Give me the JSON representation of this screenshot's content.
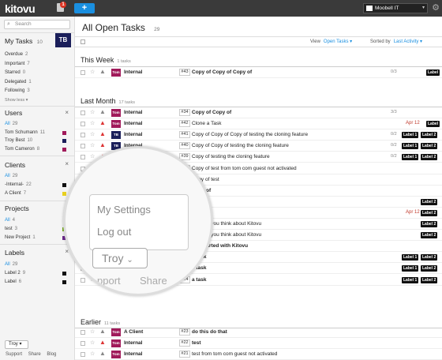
{
  "topbar": {
    "logo": "kitovu",
    "notif_count": "1",
    "add_label": "+",
    "org": "Moobell IT",
    "org_caret": "▾",
    "gear": "⚙"
  },
  "sidebar": {
    "search_placeholder": "Search",
    "mytasks": {
      "title": "My Tasks",
      "count": "10",
      "badge": "TB",
      "items": [
        {
          "label": "Overdue",
          "count": "2"
        },
        {
          "label": "Important",
          "count": "7"
        },
        {
          "label": "Starred",
          "count": "0"
        },
        {
          "label": "Delegated",
          "count": "1"
        },
        {
          "label": "Following",
          "count": "3"
        }
      ],
      "show_less": "Show less ▾"
    },
    "users": {
      "title": "Users",
      "close": "×",
      "items": [
        {
          "label": "All",
          "count": "29"
        },
        {
          "label": "Tom Schumann",
          "count": "11"
        },
        {
          "label": "Troy Best",
          "count": "10"
        },
        {
          "label": "Tom Cameron",
          "count": "8"
        }
      ]
    },
    "clients": {
      "title": "Clients",
      "close": "×",
      "items": [
        {
          "label": "All",
          "count": "29"
        },
        {
          "label": "-Internal-",
          "count": "22"
        },
        {
          "label": "A Client",
          "count": "7"
        }
      ]
    },
    "projects": {
      "title": "Projects",
      "close": "×",
      "items": [
        {
          "label": "All",
          "count": "4"
        },
        {
          "label": "test",
          "count": "3"
        },
        {
          "label": "New Project",
          "count": "1"
        }
      ]
    },
    "labels": {
      "title": "Labels",
      "close": "×",
      "items": [
        {
          "label": "All",
          "count": "29"
        },
        {
          "label": "Label 2",
          "count": "9"
        },
        {
          "label": "Label",
          "count": "6"
        }
      ]
    },
    "footer": {
      "user_button": "Troy ▾",
      "support": "Support",
      "share": "Share",
      "blog": "Blog"
    }
  },
  "main": {
    "title": "All Open Tasks",
    "count": "29",
    "view_label": "View",
    "view_value": "Open Tasks ▾",
    "sort_label": "Sorted by",
    "sort_value": "Last Activity ▾",
    "sections": [
      {
        "title": "This Week",
        "count": "1 tasks"
      },
      {
        "title": "Last Month",
        "count": "17 tasks"
      },
      {
        "title": "Earlier",
        "count": "11 tasks"
      }
    ],
    "rows_this_week": [
      {
        "av": "Tom",
        "project": "Internal",
        "num": "#43",
        "title": "Copy of Copy of Copy of",
        "bold": true,
        "sub": "0/3",
        "labels": [
          "Label"
        ]
      }
    ],
    "rows_last_month": [
      {
        "av": "Tom",
        "project": "Internal",
        "num": "#34",
        "title": "Copy of Copy of",
        "bold": true,
        "sub": "3/3",
        "labels": []
      },
      {
        "av": "Tom",
        "project": "Internal",
        "num": "#42",
        "title": "Clone a Task",
        "bold": false,
        "date": "Apr 12",
        "labels": [
          "Label"
        ]
      },
      {
        "av": "TB",
        "project": "Internal",
        "num": "#41",
        "title": "Copy of Copy of Copy of testing the cloning feature",
        "bold": false,
        "sub": "0/2",
        "labels": [
          "Label 1",
          "Label 2"
        ]
      },
      {
        "av": "TB",
        "project": "Internal",
        "num": "#40",
        "title": "Copy of Copy of testing the cloning feature",
        "bold": false,
        "sub": "0/2",
        "labels": [
          "Label 1",
          "Label 2"
        ]
      },
      {
        "av": "TB",
        "project": "Internal",
        "num": "#39",
        "title": "Copy of testing the cloning feature",
        "bold": false,
        "sub": "0/2",
        "labels": [
          "Label 1",
          "Label 2"
        ]
      },
      {
        "av": "",
        "project": "",
        "num": "#36",
        "title": "Copy of test from tom com guest not activated",
        "bold": false,
        "labels": []
      },
      {
        "av": "",
        "project": "",
        "num": "#35",
        "title": "Copy of test",
        "bold": false,
        "labels": []
      },
      {
        "av": "",
        "project": "",
        "num": "",
        "title": "Copy of",
        "bold": true,
        "labels": []
      },
      {
        "av": "",
        "project": "",
        "num": "",
        "title": "",
        "bold": false,
        "labels": [
          "Label 2"
        ]
      },
      {
        "av": "",
        "project": "",
        "num": "",
        "title": "",
        "bold": false,
        "date": "Apr 12",
        "labels": [
          "Label 2"
        ]
      },
      {
        "av": "",
        "project": "",
        "num": "",
        "title": "us what you think about Kitovu",
        "bold": false,
        "labels": [
          "Label 2"
        ]
      },
      {
        "av": "",
        "project": "",
        "num": "",
        "title": "us what you think about Kitovu",
        "bold": false,
        "labels": [
          "Label 2"
        ]
      },
      {
        "av": "",
        "project": "",
        "num": "",
        "title": "Get started with Kitovu",
        "bold": true,
        "labels": []
      },
      {
        "av": "",
        "project": "",
        "num": "#26",
        "title": "a task",
        "bold": true,
        "labels": [
          "Label 1",
          "Label 2"
        ]
      },
      {
        "av": "Tom",
        "project": "",
        "num": "#25",
        "title": "a task",
        "bold": true,
        "labels": [
          "Label 1",
          "Label 2"
        ]
      },
      {
        "av": "Tom",
        "project": "A Client",
        "num": "#24",
        "title": "a task",
        "bold": true,
        "labels": [
          "Label 1",
          "Label 2"
        ]
      }
    ],
    "rows_earlier": [
      {
        "av": "Tom",
        "project": "A Client",
        "num": "#23",
        "title": "do this do that",
        "bold": true,
        "labels": []
      },
      {
        "av": "Tom",
        "project": "Internal",
        "num": "#22",
        "title": "test",
        "bold": true,
        "labels": []
      },
      {
        "av": "Tom",
        "project": "Internal",
        "num": "#21",
        "title": "test from tom com guest not activated",
        "bold": false,
        "labels": []
      }
    ]
  },
  "magnifier": {
    "menu_items": [
      "My Settings",
      "Log out"
    ],
    "user_button": "Troy",
    "footer_support": "pport",
    "footer_share": "Share"
  }
}
